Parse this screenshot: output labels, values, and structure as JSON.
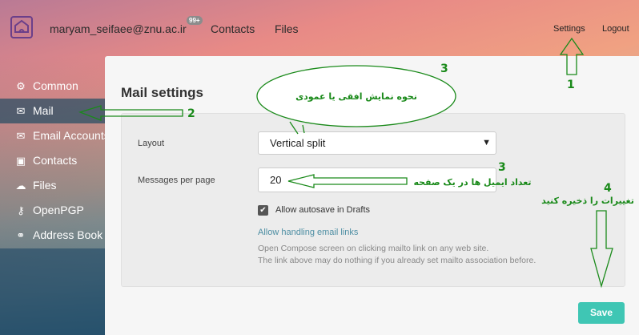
{
  "header": {
    "email": "maryam_seifaee@znu.ac.ir",
    "badge": "99+",
    "nav_contacts": "Contacts",
    "nav_files": "Files",
    "settings": "Settings",
    "logout": "Logout"
  },
  "sidebar": {
    "items": [
      {
        "label": "Common",
        "icon": "gear-icon"
      },
      {
        "label": "Mail",
        "icon": "envelope-icon"
      },
      {
        "label": "Email Accounts",
        "icon": "envelope-icon"
      },
      {
        "label": "Contacts",
        "icon": "contact-card-icon"
      },
      {
        "label": "Files",
        "icon": "cloud-icon"
      },
      {
        "label": "OpenPGP",
        "icon": "key-icon"
      },
      {
        "label": "Address Book",
        "icon": "people-icon"
      }
    ]
  },
  "main": {
    "title": "Mail settings",
    "layout_label": "Layout",
    "layout_value": "Vertical split",
    "per_page_label": "Messages per page",
    "per_page_value": "20",
    "autosave_label": "Allow autosave in Drafts",
    "autosave_checked": true,
    "handling_link": "Allow handling email links",
    "note1": "Open Compose screen on clicking mailto link on any web site.",
    "note2": "The link above may do nothing if you already set mailto association before.",
    "save_label": "Save"
  },
  "annotations": {
    "n1": "1",
    "n2": "2",
    "n3a": "3",
    "n3b": "3",
    "n4": "4",
    "bubble": "نحوه نمایش افقی یا عمودی",
    "per_page_note": "تعداد ایمیل ها در یک صفحه",
    "save_note": "تغییرات را ذخیره کنید",
    "color": "#1a8a1a"
  },
  "colors": {
    "accent": "#3fc6b4",
    "link": "#4d8ea3"
  }
}
